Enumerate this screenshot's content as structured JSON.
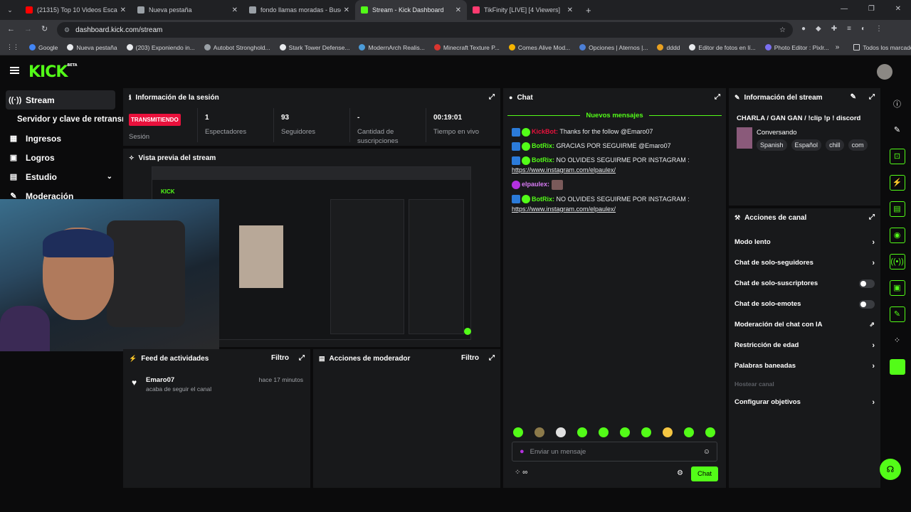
{
  "browser": {
    "tabs": [
      {
        "label": "(21315) Top 10 Videos Escalofri",
        "color": "#ff0000"
      },
      {
        "label": "Nueva pestaña",
        "color": "#9aa0a6"
      },
      {
        "label": "fondo llamas moradas - Buscar",
        "color": "#9aa0a6"
      },
      {
        "label": "Stream - Kick Dashboard",
        "color": "#53fc18"
      },
      {
        "label": "TikFinity [LIVE] [4 Viewers]",
        "color": "#ff3b70"
      }
    ],
    "url": "dashboard.kick.com/stream",
    "bookmarks": [
      "Google",
      "Nueva pestaña",
      "(203) Exponiendo in...",
      "Autobot Stronghold...",
      "Stark Tower Defense...",
      "ModernArch Realis...",
      "Minecraft Texture P...",
      "Comes Alive Mod...",
      "Opciones | Aternos |...",
      "dddd",
      "Editor de fotos en lí...",
      "Photo Editor : Pixlr..."
    ],
    "all_bookmarks": "Todos los marcadores"
  },
  "kick": {
    "logo": "KICK",
    "logo_badge": "BETA",
    "nav": [
      {
        "label": "Stream",
        "icon": "((·))"
      },
      {
        "label": "Servidor y clave de retransm",
        "icon": ""
      },
      {
        "label": "Ingresos",
        "icon": "▦"
      },
      {
        "label": "Logros",
        "icon": "▣"
      },
      {
        "label": "Estudio",
        "icon": "▤"
      },
      {
        "label": "Moderación",
        "icon": "✎"
      }
    ],
    "session": {
      "title": "Información de la sesión",
      "status_badge": "TRANSMITIENDO",
      "status_label": "Sesión",
      "viewers": "1",
      "viewers_label": "Espectadores",
      "followers": "93",
      "followers_label": "Seguidores",
      "subs": "-",
      "subs_label": "Cantidad de suscripciones",
      "uptime": "00:19:01",
      "uptime_label": "Tiempo en vivo"
    },
    "preview": {
      "title": "Vista previa del stream"
    },
    "activity": {
      "title": "Feed de actividades",
      "filter": "Filtro",
      "user": "Emaro07",
      "text": "acaba de seguir el canal",
      "time": "hace 17 minutos"
    },
    "modactions": {
      "title": "Acciones de moderador",
      "filter": "Filtro"
    },
    "chat": {
      "title": "Chat",
      "new_messages": "Nuevos mensajes",
      "m1_user": "KickBot:",
      "m1_text": "Thanks for the follow @Emaro07",
      "m2_user": "BotRix:",
      "m2_text": "GRACIAS POR SEGUIRME @Emaro07",
      "m3_user": "BotRix:",
      "m3_text": "NO OLVIDES SEGUIRME POR INSTAGRAM :",
      "m3_link": "https://www.instagram.com/elpaulex/",
      "m4_user": "elpaulex:",
      "m5_user": "BotRix:",
      "m5_text": "NO OLVIDES SEGUIRME POR INSTAGRAM :",
      "m5_link": "https://www.instagram.com/elpaulex/",
      "placeholder": "Enviar un mensaje",
      "send": "Chat",
      "infinity": "∞"
    },
    "stream_info": {
      "title": "Información del stream",
      "stream_title": "CHARLA / GAN GAN / !clip !p ! discord",
      "category": "Conversando",
      "tags": [
        "Spanish",
        "Español",
        "chill",
        "com"
      ]
    },
    "channel_actions": {
      "title": "Acciones de canal",
      "items": [
        {
          "label": "Modo lento",
          "ctrl": "chev"
        },
        {
          "label": "Chat de solo-seguidores",
          "ctrl": "chev"
        },
        {
          "label": "Chat de solo-suscriptores",
          "ctrl": "tog"
        },
        {
          "label": "Chat de solo-emotes",
          "ctrl": "tog"
        },
        {
          "label": "Moderación del chat con IA",
          "ctrl": "ext"
        },
        {
          "label": "Restricción de edad",
          "ctrl": "chev"
        },
        {
          "label": "Palabras baneadas",
          "ctrl": "chev"
        },
        {
          "label": "Hostear canal",
          "ctrl": "none"
        },
        {
          "label": "Configurar objetivos",
          "ctrl": "chev"
        }
      ]
    },
    "colors": {
      "accent": "#53fc18",
      "live": "#e9113c",
      "panel": "#18191b"
    }
  }
}
